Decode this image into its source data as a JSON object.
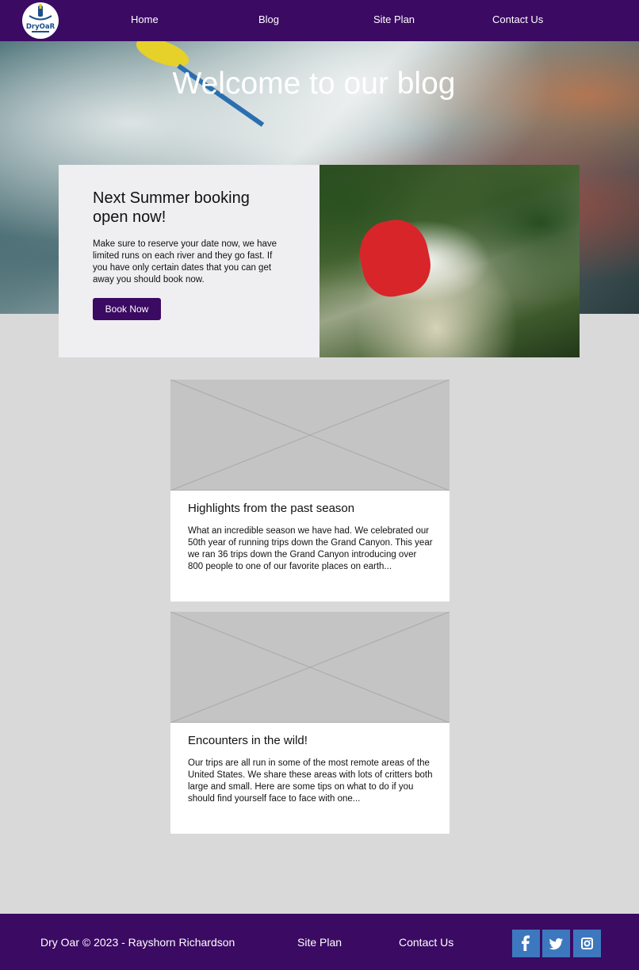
{
  "nav": {
    "logo_text": "DryOaR",
    "items": [
      {
        "label": "Home"
      },
      {
        "label": "Blog"
      },
      {
        "label": "Site Plan"
      },
      {
        "label": "Contact Us"
      }
    ]
  },
  "hero": {
    "title": "Welcome to our blog"
  },
  "promo": {
    "title": "Next Summer booking open now!",
    "text": "Make sure to reserve your date now, we have limited runs on each river and they go fast. If you have only certain dates that you can get away you should book now.",
    "button_label": "Book Now"
  },
  "posts": [
    {
      "title": "Highlights from the past season",
      "excerpt": "What an incredible season we have had. We celebrated our 50th year of running trips down the Grand Canyon. This year we ran 36 trips down the Grand Canyon introducing over 800 people to one of our favorite places on earth..."
    },
    {
      "title": "Encounters in the wild!",
      "excerpt": "Our trips are all run in some of the most remote areas of the United States. We share these areas with lots of critters both large and small. Here are some tips on what to do if you should find yourself face to face with one..."
    }
  ],
  "footer": {
    "copyright": "Dry Oar © 2023 - Rayshorn Richardson",
    "site_plan": "Site Plan",
    "contact_us": "Contact Us",
    "social": [
      "facebook-icon",
      "twitter-icon",
      "instagram-icon"
    ]
  },
  "colors": {
    "brand_purple": "#3b0a63",
    "social_blue": "#3d78be",
    "page_bg": "#d9d9d9",
    "placeholder_gray": "#c4c4c4"
  }
}
